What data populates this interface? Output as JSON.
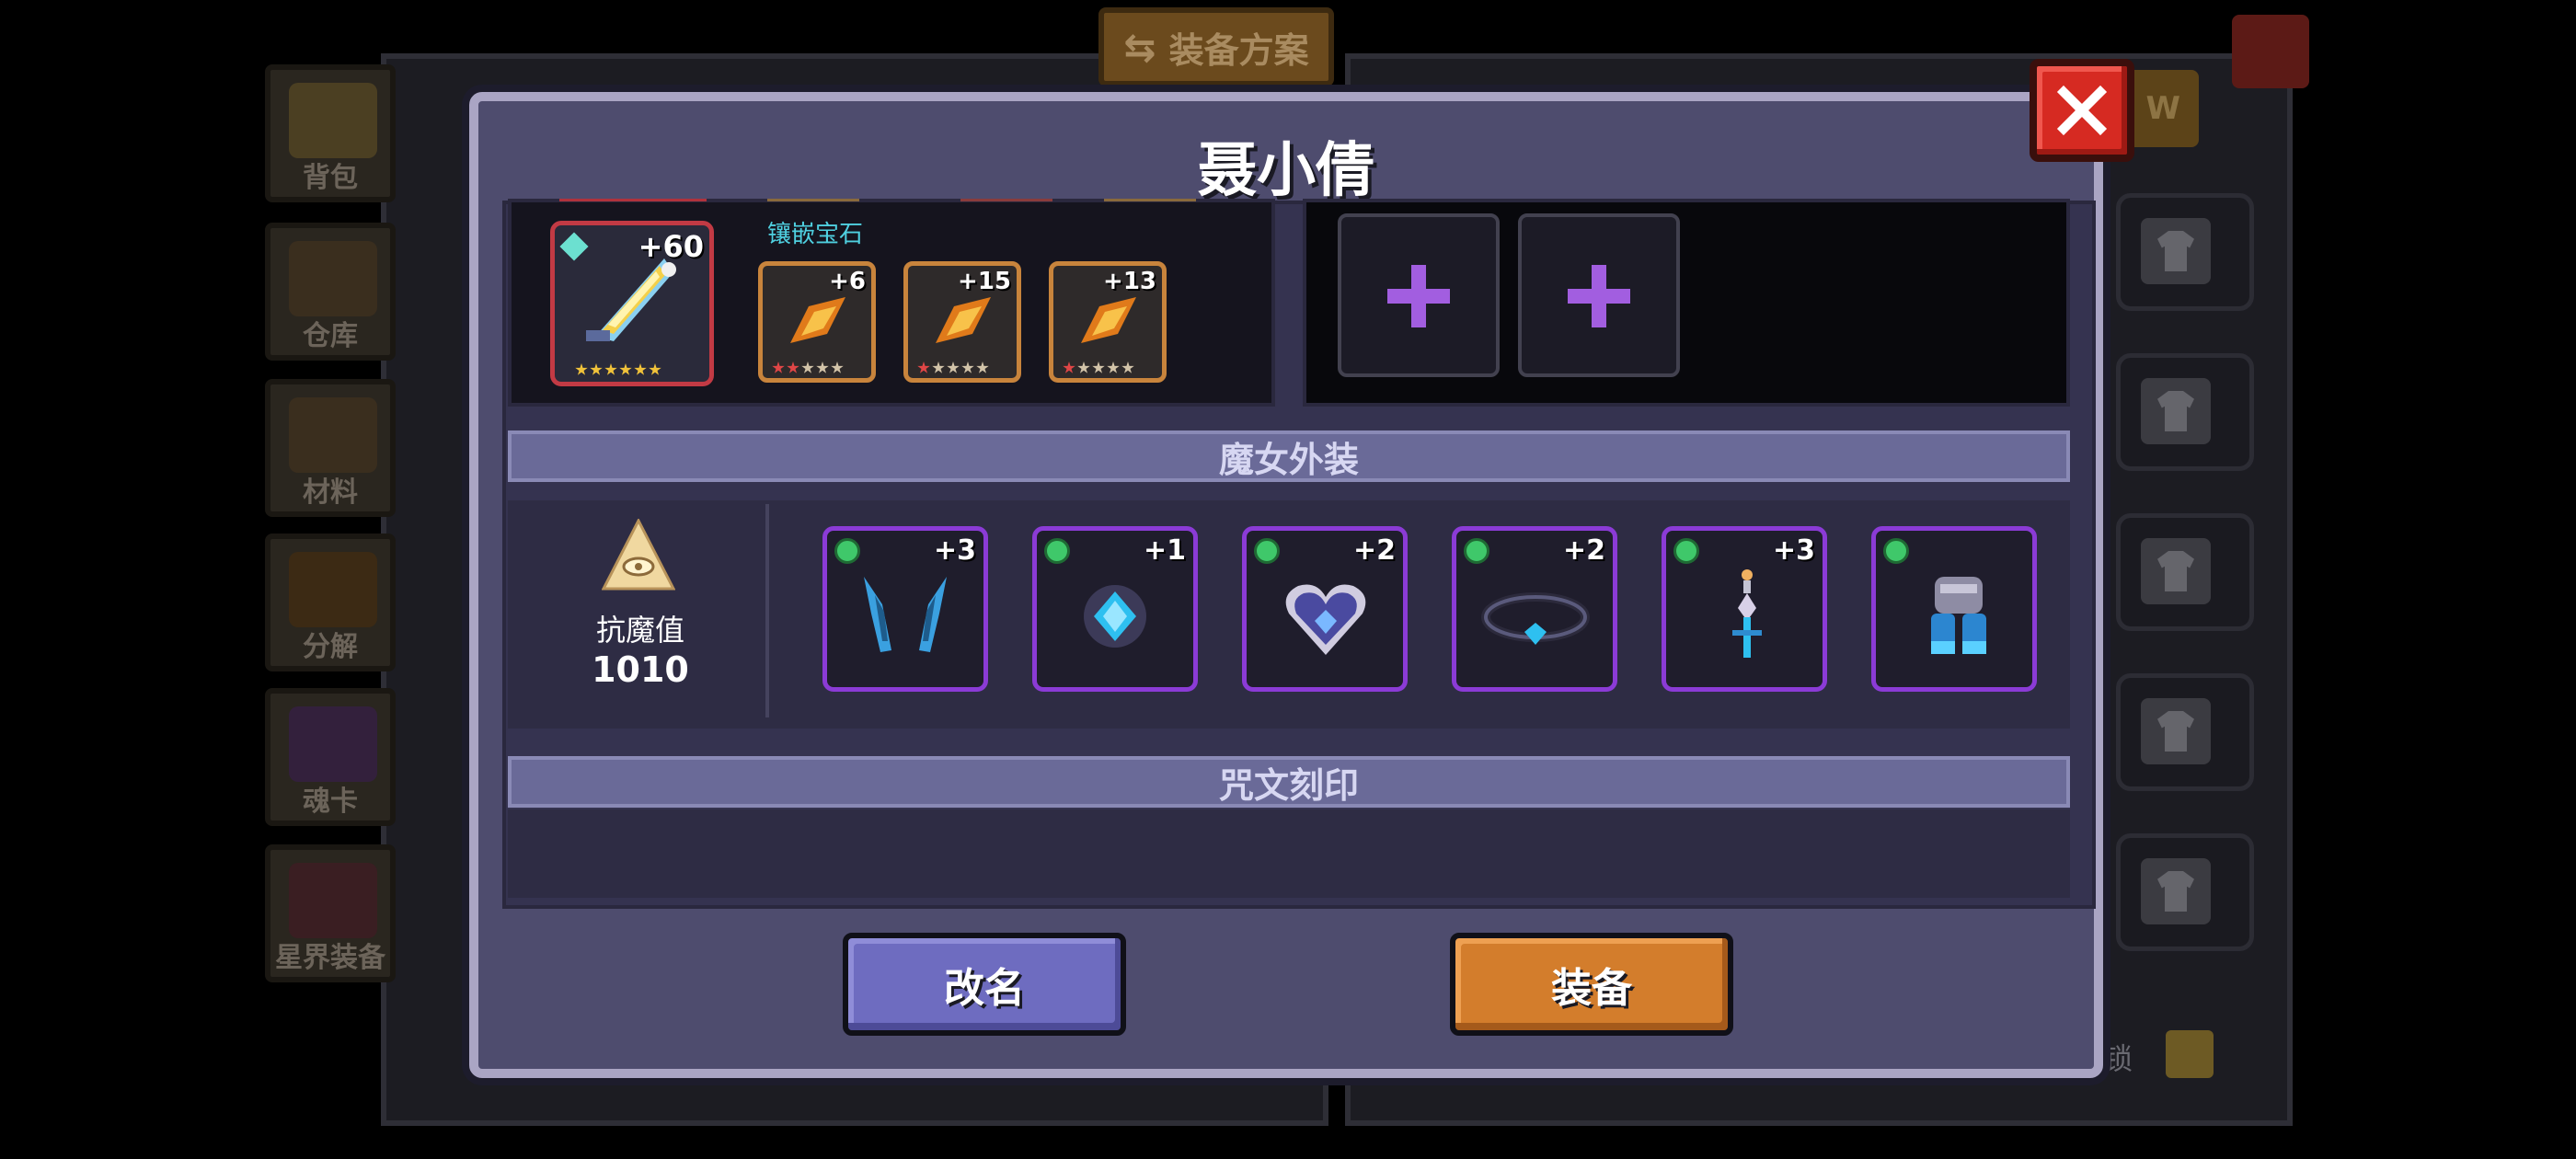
{
  "background": {
    "scheme_button_label": "装备方案",
    "sidebar": [
      {
        "label": "背包",
        "name": "backpack"
      },
      {
        "label": "仓库",
        "name": "warehouse"
      },
      {
        "label": "材料",
        "name": "materials"
      },
      {
        "label": "分解",
        "name": "decompose"
      },
      {
        "label": "魂卡",
        "name": "soul-card"
      },
      {
        "label": "星界装备",
        "name": "astral-equipment"
      }
    ],
    "right_lock_text": "锁",
    "right_top_tag": "W"
  },
  "modal": {
    "title": "聂小倩",
    "gem_section": {
      "gem_label": "镶嵌宝石",
      "main_item_level": "+60",
      "gems": [
        {
          "level": "+6"
        },
        {
          "level": "+15"
        },
        {
          "level": "+13"
        }
      ]
    },
    "skin_section": {
      "title": "魔女外装",
      "resist_label": "抗魔值",
      "resist_value": "1010",
      "items": [
        {
          "level": "+3",
          "icon": "horns-icon"
        },
        {
          "level": "+1",
          "icon": "blue-gem-amulet-icon"
        },
        {
          "level": "+2",
          "icon": "heart-pendant-icon"
        },
        {
          "level": "+2",
          "icon": "choker-icon"
        },
        {
          "level": "+3",
          "icon": "sword-earring-icon"
        },
        {
          "level": "",
          "icon": "boots-icon"
        }
      ]
    },
    "spell_section": {
      "title": "咒文刻印"
    },
    "buttons": {
      "rename": "改名",
      "equip": "装备"
    }
  },
  "colors": {
    "modal_bg": "#4e4c6e",
    "close_red": "#d62a22",
    "rename_purple": "#6e6cc0",
    "equip_orange": "#d37d2c",
    "skin_border": "#8b3bd6",
    "plus_purple": "#a25ee0"
  }
}
